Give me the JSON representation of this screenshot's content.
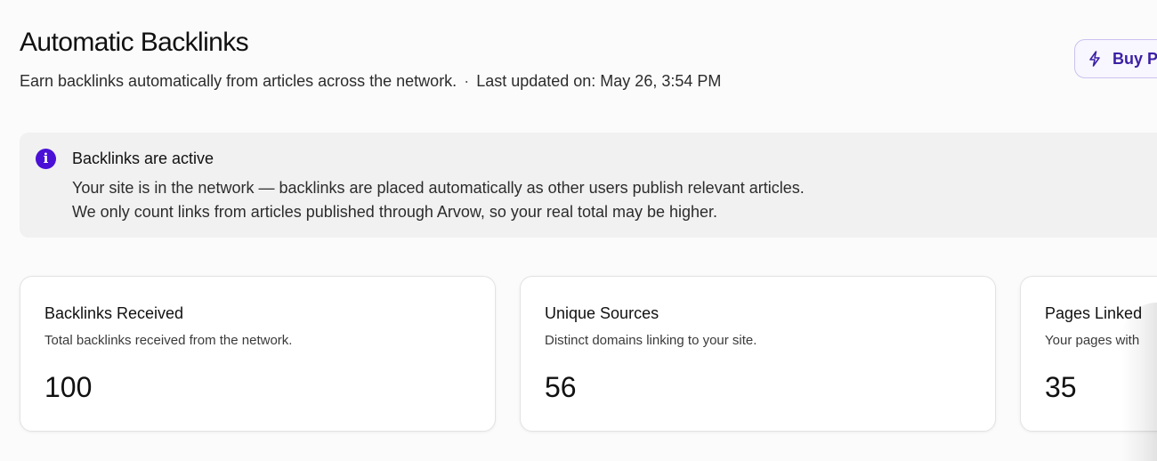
{
  "header": {
    "title": "Automatic Backlinks",
    "description": "Earn backlinks automatically from articles across the network.",
    "separator": "·",
    "last_updated": "Last updated on: May 26, 3:54 PM",
    "buy_button_label": "Buy P",
    "buy_button_icon": "lightning-icon"
  },
  "notice": {
    "icon": "info-icon",
    "icon_glyph": "i",
    "title": "Backlinks are active",
    "line1": "Your site is in the network — backlinks are placed automatically as other users publish relevant articles.",
    "line2": "We only count links from articles published through Arvow, so your real total may be higher."
  },
  "stats": [
    {
      "title": "Backlinks Received",
      "description": "Total backlinks received from the network.",
      "value": "100"
    },
    {
      "title": "Unique Sources",
      "description": "Distinct domains linking to your site.",
      "value": "56"
    },
    {
      "title": "Pages Linked",
      "description": "Your pages with",
      "value": "35"
    }
  ],
  "colors": {
    "accent": "#4a10d6",
    "button_text": "#3b1fa5",
    "button_border": "#cbc2ef",
    "notice_bg": "#f1f1f1"
  }
}
